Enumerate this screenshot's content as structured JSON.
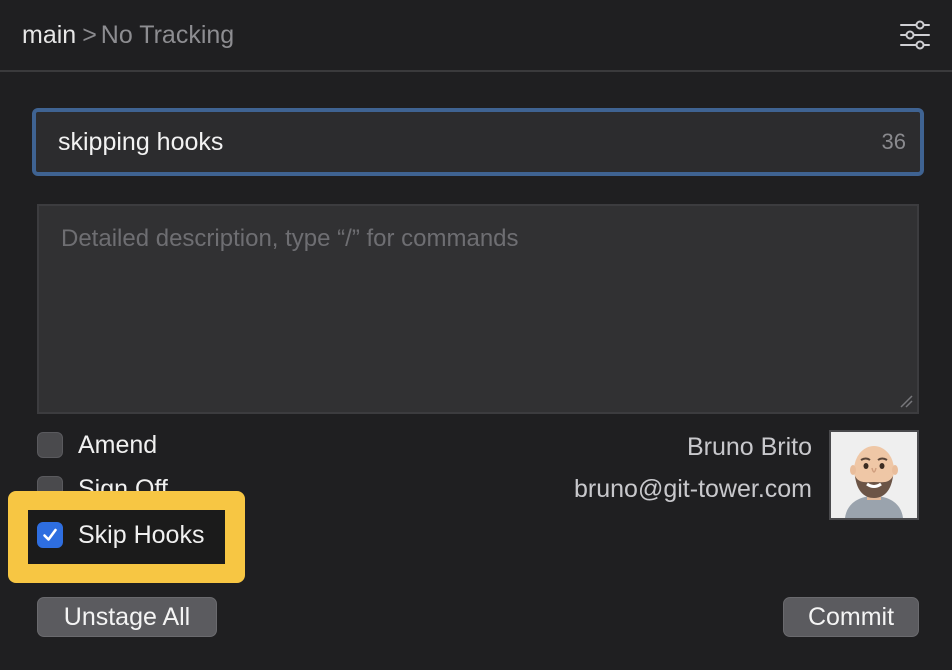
{
  "header": {
    "branch": "main",
    "separator": ">",
    "tracking": "No Tracking",
    "settings_icon": "sliders-icon"
  },
  "commit": {
    "summary_value": "skipping hooks",
    "summary_char_count": "36",
    "description_placeholder": "Detailed description, type “/” for commands"
  },
  "options": {
    "amend": {
      "label": "Amend",
      "checked": false
    },
    "sign_off": {
      "label": "Sign Off",
      "checked": false
    },
    "skip_hooks": {
      "label": "Skip Hooks",
      "checked": true
    }
  },
  "author": {
    "name": "Bruno Brito",
    "email": "bruno@git-tower.com"
  },
  "buttons": {
    "unstage_all": "Unstage All",
    "commit": "Commit"
  },
  "colors": {
    "background": "#1f1f21",
    "focus_border": "#3f6392",
    "checkbox_checked": "#2e6ee0",
    "highlight": "#f7c643"
  }
}
